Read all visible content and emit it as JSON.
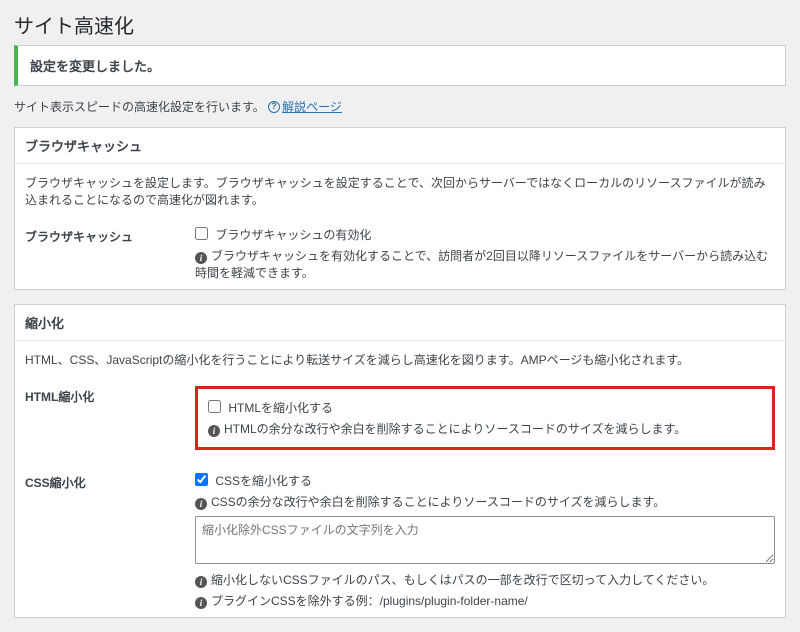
{
  "header": {
    "title": "サイト高速化"
  },
  "notice": {
    "message": "設定を変更しました。"
  },
  "intro": {
    "text": "サイト表示スピードの高速化設定を行います。",
    "help_label": "解説ページ"
  },
  "sections": {
    "browser_cache": {
      "heading": "ブラウザキャッシュ",
      "desc": "ブラウザキャッシュを設定します。ブラウザキャッシュを設定することで、次回からサーバーではなくローカルのリソースファイルが読み込まれることになるので高速化が図れます。",
      "row_label": "ブラウザキャッシュ",
      "checkbox_label": "ブラウザキャッシュの有効化",
      "hint": "ブラウザキャッシュを有効化することで、訪問者が2回目以降リソースファイルをサーバーから読み込む時間を軽減できます。"
    },
    "minify": {
      "heading": "縮小化",
      "desc": "HTML、CSS、JavaScriptの縮小化を行うことにより転送サイズを減らし高速化を図ります。AMPページも縮小化されます。",
      "html": {
        "row_label": "HTML縮小化",
        "checkbox_label": "HTMLを縮小化する",
        "hint": "HTMLの余分な改行や余白を削除することによりソースコードのサイズを減らします。"
      },
      "css": {
        "row_label": "CSS縮小化",
        "checkbox_label": "CSSを縮小化する",
        "hint": "CSSの余分な改行や余白を削除することによりソースコードのサイズを減らします。",
        "textarea_placeholder": "縮小化除外CSSファイルの文字列を入力",
        "exclude_hint": "縮小化しないCSSファイルのパス、もしくはパスの一部を改行で区切って入力してください。",
        "example_hint": "プラグインCSSを除外する例：/plugins/plugin-folder-name/"
      }
    }
  }
}
